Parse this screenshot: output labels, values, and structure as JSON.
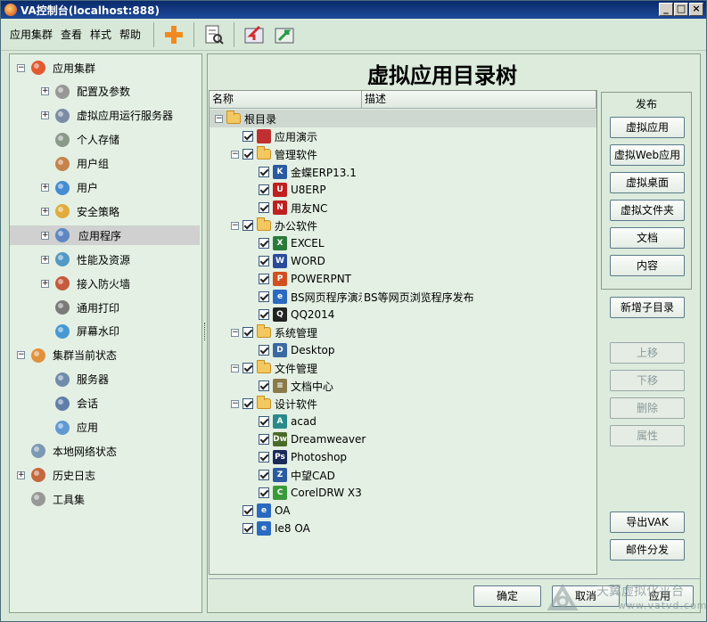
{
  "window": {
    "title": "VA控制台(localhost:888)"
  },
  "menu": [
    "应用集群",
    "查看",
    "样式",
    "帮助"
  ],
  "toolbar": {
    "buttons": [
      "add-icon",
      "search-doc-icon",
      "import-icon",
      "export-icon"
    ]
  },
  "left_tree": [
    {
      "label": "应用集群",
      "level": 0,
      "expander": "−",
      "icon": "cluster-icon"
    },
    {
      "label": "配置及参数",
      "level": 1,
      "expander": "+",
      "icon": "gear-icon"
    },
    {
      "label": "虚拟应用运行服务器",
      "level": 1,
      "expander": "+",
      "icon": "server-icon"
    },
    {
      "label": "个人存储",
      "level": 1,
      "expander": "",
      "icon": "storage-icon"
    },
    {
      "label": "用户组",
      "level": 1,
      "expander": "",
      "icon": "usergroup-icon"
    },
    {
      "label": "用户",
      "level": 1,
      "expander": "+",
      "icon": "user-icon"
    },
    {
      "label": "安全策略",
      "level": 1,
      "expander": "+",
      "icon": "lock-icon"
    },
    {
      "label": "应用程序",
      "level": 1,
      "expander": "+",
      "icon": "app-icon",
      "selected": true
    },
    {
      "label": "性能及资源",
      "level": 1,
      "expander": "+",
      "icon": "performance-icon"
    },
    {
      "label": "接入防火墙",
      "level": 1,
      "expander": "+",
      "icon": "firewall-icon"
    },
    {
      "label": "通用打印",
      "level": 1,
      "expander": "",
      "icon": "printer-icon"
    },
    {
      "label": "屏幕水印",
      "level": 1,
      "expander": "",
      "icon": "watermark-tag-icon"
    },
    {
      "label": "集群当前状态",
      "level": 0,
      "expander": "−",
      "icon": "bar-chart-icon"
    },
    {
      "label": "服务器",
      "level": 1,
      "expander": "",
      "icon": "server-status-icon"
    },
    {
      "label": "会话",
      "level": 1,
      "expander": "",
      "icon": "session-icon"
    },
    {
      "label": "应用",
      "level": 1,
      "expander": "",
      "icon": "app-grid-icon"
    },
    {
      "label": "本地网络状态",
      "level": 0,
      "expander": "",
      "icon": "network-icon"
    },
    {
      "label": "历史日志",
      "level": 0,
      "expander": "+",
      "icon": "log-icon"
    },
    {
      "label": "工具集",
      "level": 0,
      "expander": "",
      "icon": "tools-icon"
    }
  ],
  "main": {
    "title": "虚拟应用目录树",
    "columns": [
      "名称",
      "描述"
    ]
  },
  "dir_tree": [
    {
      "label": "根目录",
      "level": 0,
      "expander": "−",
      "checkbox": false,
      "icon": "folder",
      "root": true
    },
    {
      "label": "应用演示",
      "level": 1,
      "expander": "",
      "checkbox": true,
      "icon": "demo-app-icon",
      "color": "#c03030"
    },
    {
      "label": "管理软件",
      "level": 1,
      "expander": "−",
      "checkbox": true,
      "icon": "folder"
    },
    {
      "label": "金蝶ERP13.1",
      "level": 2,
      "expander": "",
      "checkbox": true,
      "icon": "kingdee-icon",
      "color": "#2a5aa0",
      "glyph": "K"
    },
    {
      "label": "U8ERP",
      "level": 2,
      "expander": "",
      "checkbox": true,
      "icon": "u8-icon",
      "color": "#c02020",
      "glyph": "U"
    },
    {
      "label": "用友NC",
      "level": 2,
      "expander": "",
      "checkbox": true,
      "icon": "nc-icon",
      "color": "#c02020",
      "glyph": "N"
    },
    {
      "label": "办公软件",
      "level": 1,
      "expander": "−",
      "checkbox": true,
      "icon": "folder"
    },
    {
      "label": "EXCEL",
      "level": 2,
      "expander": "",
      "checkbox": true,
      "icon": "excel-icon",
      "color": "#2a7a3a",
      "glyph": "X"
    },
    {
      "label": "WORD",
      "level": 2,
      "expander": "",
      "checkbox": true,
      "icon": "word-icon",
      "color": "#2a4a9a",
      "glyph": "W"
    },
    {
      "label": "POWERPNT",
      "level": 2,
      "expander": "",
      "checkbox": true,
      "icon": "powerpoint-icon",
      "color": "#d05020",
      "glyph": "P"
    },
    {
      "label": "BS网页程序演示",
      "desc": "BS等网页浏览程序发布",
      "level": 2,
      "expander": "",
      "checkbox": true,
      "icon": "ie-icon",
      "color": "#2a6ac0",
      "glyph": "e"
    },
    {
      "label": "QQ2014",
      "level": 2,
      "expander": "",
      "checkbox": true,
      "icon": "qq-icon",
      "color": "#222",
      "glyph": "Q"
    },
    {
      "label": "系统管理",
      "level": 1,
      "expander": "−",
      "checkbox": true,
      "icon": "folder"
    },
    {
      "label": "Desktop",
      "level": 2,
      "expander": "",
      "checkbox": true,
      "icon": "desktop-icon",
      "color": "#3a6aa0",
      "glyph": "D"
    },
    {
      "label": "文件管理",
      "level": 1,
      "expander": "−",
      "checkbox": true,
      "icon": "folder"
    },
    {
      "label": "文档中心",
      "level": 2,
      "expander": "",
      "checkbox": true,
      "icon": "doc-center-icon",
      "color": "#8a7a4a",
      "glyph": "≡"
    },
    {
      "label": "设计软件",
      "level": 1,
      "expander": "−",
      "checkbox": true,
      "icon": "folder"
    },
    {
      "label": "acad",
      "level": 2,
      "expander": "",
      "checkbox": true,
      "icon": "autocad-icon",
      "color": "#2a8a8a",
      "glyph": "A"
    },
    {
      "label": "Dreamweaver",
      "level": 2,
      "expander": "",
      "checkbox": true,
      "icon": "dreamweaver-icon",
      "color": "#4a6a2a",
      "glyph": "Dw"
    },
    {
      "label": "Photoshop",
      "level": 2,
      "expander": "",
      "checkbox": true,
      "icon": "photoshop-icon",
      "color": "#1a2a5a",
      "glyph": "Ps"
    },
    {
      "label": "中望CAD",
      "level": 2,
      "expander": "",
      "checkbox": true,
      "icon": "zwcad-icon",
      "color": "#2a5aa0",
      "glyph": "Z"
    },
    {
      "label": "CorelDRW X3",
      "level": 2,
      "expander": "",
      "checkbox": true,
      "icon": "coreldraw-icon",
      "color": "#3a9a3a",
      "glyph": "C"
    },
    {
      "label": "OA",
      "level": 1,
      "expander": "",
      "checkbox": true,
      "icon": "ie-oa-icon",
      "color": "#2a6ac0",
      "glyph": "e"
    },
    {
      "label": "Ie8 OA",
      "level": 1,
      "expander": "",
      "checkbox": true,
      "icon": "ie8-oa-icon",
      "color": "#2a6ac0",
      "glyph": "e"
    }
  ],
  "publish": {
    "legend": "发布",
    "buttons": [
      "虚拟应用",
      "虚拟Web应用",
      "虚拟桌面",
      "虚拟文件夹",
      "文档",
      "内容"
    ]
  },
  "side_buttons": {
    "add_subdir": "新增子目录",
    "move_up": "上移",
    "move_down": "下移",
    "delete": "删除",
    "properties": "属性",
    "export_vak": "导出VAK",
    "mail": "邮件分发"
  },
  "footer": {
    "ok": "确定",
    "cancel": "取消",
    "apply": "应用"
  },
  "watermark": {
    "brand": "天翼虚拟化平台",
    "url": "www.vatvd.com"
  }
}
